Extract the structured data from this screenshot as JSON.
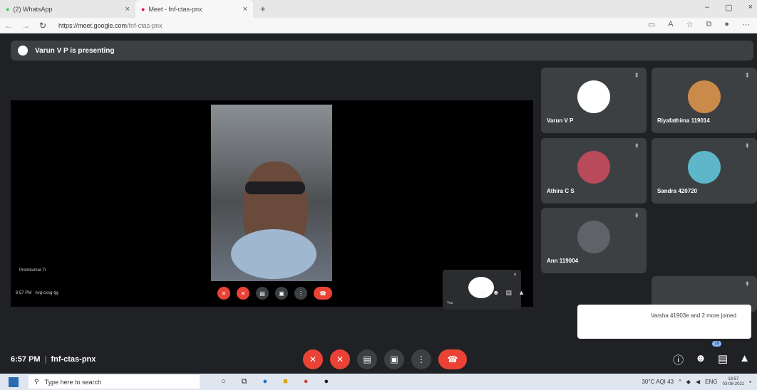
{
  "browser": {
    "tabs": [
      {
        "label": "(2) WhatsApp",
        "close": "×"
      },
      {
        "label": "Meet - fnf-ctas-pnx",
        "close": "×"
      }
    ],
    "new_tab": "+",
    "window_controls": [
      "–",
      "▢",
      "×"
    ],
    "url_host": "https://meet.google.com",
    "url_path": "/fnf-ctas-pnx"
  },
  "meet": {
    "presenting_banner": "Varun V P is presenting",
    "presenter_label": "Premkumar Tr",
    "inner_time": "6:57 PM",
    "inner_code": "nvg-cxsg-tjg",
    "you_label": "You",
    "participants": [
      {
        "name": "Varun V P",
        "avatar_color": "#ffffff"
      },
      {
        "name": "Riyafathima 119014",
        "avatar_color": "#c98a4a"
      },
      {
        "name": "Athira C S",
        "avatar_color": "#b84a5a"
      },
      {
        "name": "Sandra 420720",
        "avatar_color": "#5db7c9"
      },
      {
        "name": "Ann 119004",
        "avatar_color": "#5f6368"
      }
    ],
    "toast": "Varsha 41903e and 2 more joined",
    "time": "6:57 PM",
    "separator": "|",
    "code": "fnf-ctas-pnx",
    "people_badge": "10"
  },
  "taskbar": {
    "search_placeholder": "Type here to search",
    "weather": "30°C  AQI 43",
    "lang": "ENG",
    "clock_time": "18:57",
    "clock_date": "03-08-2021"
  },
  "colors": {
    "meet_bg": "#202124",
    "tile_bg": "#3c4043",
    "end_red": "#ea4335"
  }
}
